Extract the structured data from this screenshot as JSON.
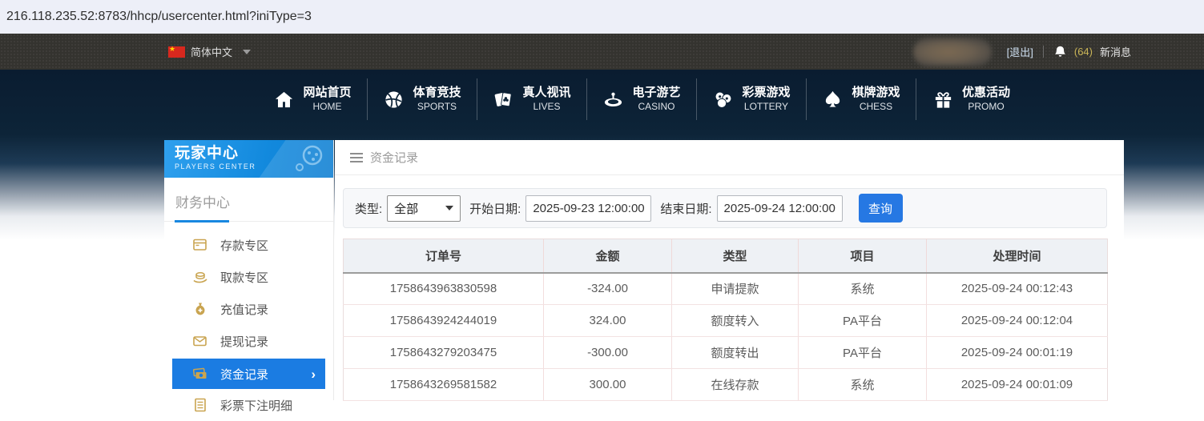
{
  "url_bar": {
    "url": "216.118.235.52:8783/hhcp/usercenter.html?iniType=3"
  },
  "topbar": {
    "language": "简体中文",
    "logout": "[退出]",
    "messages_count": "(64)",
    "messages_label": "新消息"
  },
  "nav": {
    "items": [
      {
        "zh": "网站首页",
        "en": "HOME"
      },
      {
        "zh": "体育竞技",
        "en": "SPORTS"
      },
      {
        "zh": "真人视讯",
        "en": "LIVES"
      },
      {
        "zh": "电子游艺",
        "en": "CASINO"
      },
      {
        "zh": "彩票游戏",
        "en": "LOTTERY"
      },
      {
        "zh": "棋牌游戏",
        "en": "CHESS"
      },
      {
        "zh": "优惠活动",
        "en": "PROMO"
      }
    ]
  },
  "sidebar": {
    "title_zh": "玩家中心",
    "title_en": "PLAYERS CENTER",
    "section": "财务中心",
    "items": [
      {
        "label": "存款专区",
        "active": false
      },
      {
        "label": "取款专区",
        "active": false
      },
      {
        "label": "充值记录",
        "active": false
      },
      {
        "label": "提现记录",
        "active": false
      },
      {
        "label": "资金记录",
        "active": true
      },
      {
        "label": "彩票下注明细",
        "active": false
      }
    ]
  },
  "main": {
    "breadcrumb": "资金记录",
    "filter": {
      "type_label": "类型:",
      "type_value": "全部",
      "start_label": "开始日期:",
      "start_value": "2025-09-23 12:00:00",
      "end_label": "结束日期:",
      "end_value": "2025-09-24 12:00:00",
      "search_label": "查询"
    },
    "table": {
      "headers": [
        "订单号",
        "金额",
        "类型",
        "项目",
        "处理时间"
      ],
      "rows": [
        [
          "1758643963830598",
          "-324.00",
          "申请提款",
          "系统",
          "2025-09-24 00:12:43"
        ],
        [
          "1758643924244019",
          "324.00",
          "额度转入",
          "PA平台",
          "2025-09-24 00:12:04"
        ],
        [
          "1758643279203475",
          "-300.00",
          "额度转出",
          "PA平台",
          "2025-09-24 00:01:19"
        ],
        [
          "1758643269581582",
          "300.00",
          "在线存款",
          "系统",
          "2025-09-24 00:01:09"
        ]
      ]
    }
  },
  "icons": {
    "chevron_right": "›"
  },
  "colors": {
    "accent_blue": "#1b7ce2",
    "button_blue": "#2678e3",
    "sidebar_header_blue": "#1289dd",
    "gold_icon": "#c9a450",
    "message_count_gold": "#c9b457",
    "nav_dark_navy": "#0d2438",
    "topbar_dark": "#34332f",
    "table_header_bg": "#eef1f5"
  }
}
